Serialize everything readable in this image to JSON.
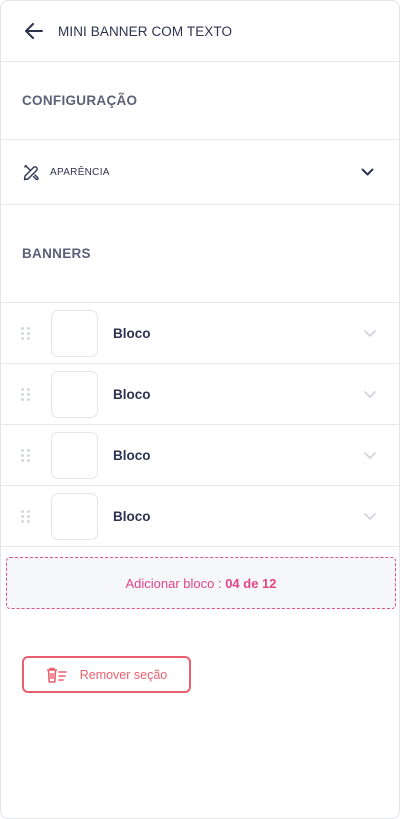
{
  "header": {
    "title": "MINI BANNER COM TEXTO",
    "back_icon": "arrow-left-icon"
  },
  "config": {
    "title": "CONFIGURAÇÃO",
    "accordion": {
      "label": "APARÊNCIA",
      "icon": "palette-brush-icon",
      "chevron": "chevron-down-icon"
    }
  },
  "banners": {
    "title": "BANNERS",
    "items": [
      {
        "label": "Bloco"
      },
      {
        "label": "Bloco"
      },
      {
        "label": "Bloco"
      },
      {
        "label": "Bloco"
      }
    ]
  },
  "add_block": {
    "label": "Adicionar bloco :",
    "count": "04 de 12"
  },
  "remove_section": {
    "label": "Remover seção",
    "icon": "trash-list-icon"
  },
  "colors": {
    "text_dark": "#2d3350",
    "text_muted": "#5b6178",
    "accent_pink": "#e24585",
    "danger": "#e8606e",
    "divider": "#e6e8ee"
  }
}
